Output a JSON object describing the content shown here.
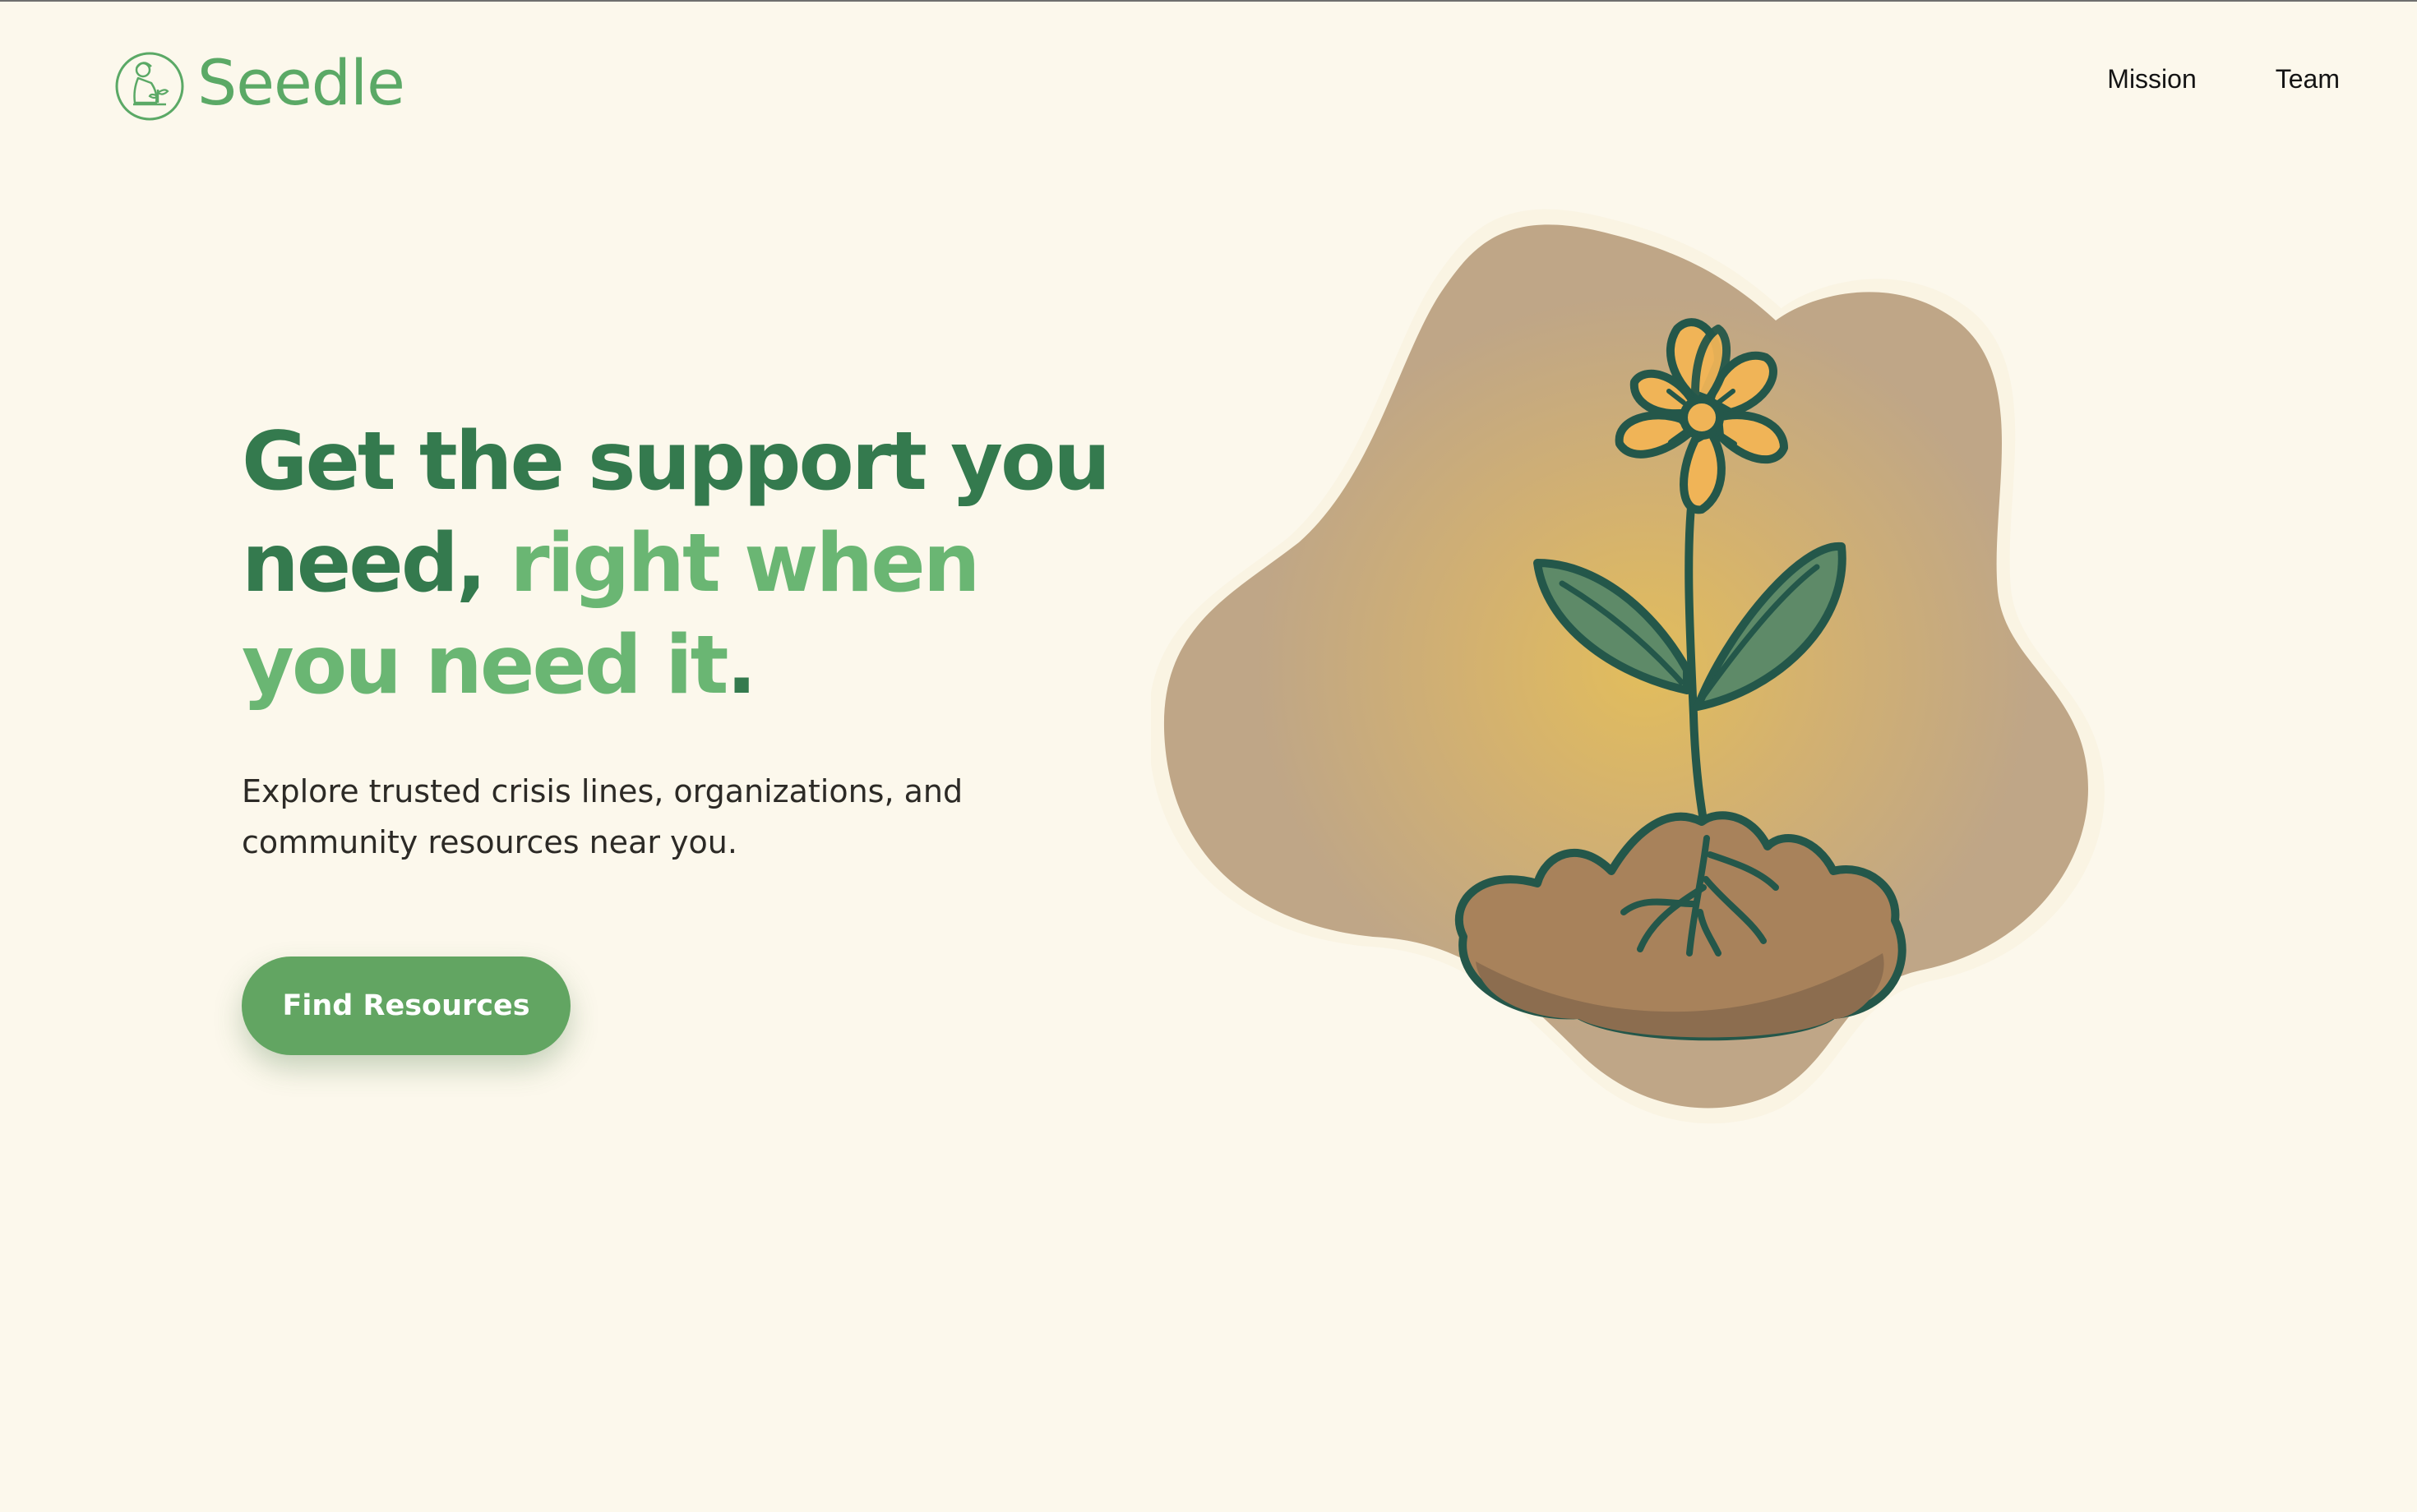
{
  "brand": {
    "name": "Seedle",
    "logo_icon": "gardener-with-sprout-icon"
  },
  "nav": {
    "items": [
      {
        "label": "Mission"
      },
      {
        "label": "Team"
      }
    ]
  },
  "hero": {
    "headline_part1": "Get the support you need, ",
    "headline_accent": "right when you need it",
    "headline_end": ".",
    "subtext": "Explore trusted crisis lines, organizations, and community resources near you.",
    "cta_label": "Find Resources",
    "illustration_icon": "flower-sprout-illustration"
  },
  "colors": {
    "background": "#fcf8ec",
    "brand_green": "#5ba966",
    "headline_dark": "#347a4e",
    "headline_accent": "#6ab673",
    "button": "#62a562",
    "blob": "#bfa687",
    "glow": "#dfbb5e",
    "petals": "#f0b457",
    "leaf": "#5e8a68",
    "soil": "#a8825b",
    "outline": "#24574a"
  }
}
